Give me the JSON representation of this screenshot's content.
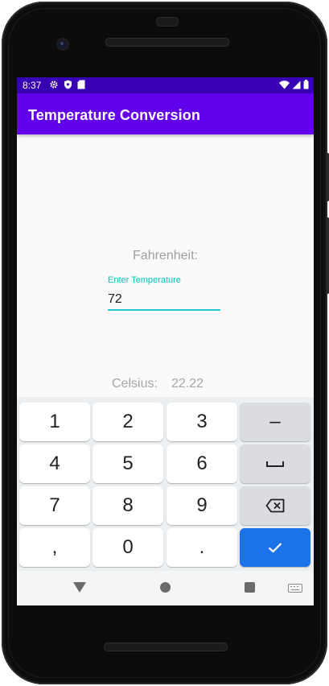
{
  "status_bar": {
    "time": "8:37",
    "icons_left": [
      "settings-icon",
      "shield-icon",
      "sd-card-icon"
    ],
    "icons_right": [
      "wifi-icon",
      "signal-icon",
      "battery-icon"
    ]
  },
  "app_bar": {
    "title": "Temperature Conversion",
    "color": "#6200ee",
    "status_color": "#3700b3"
  },
  "main": {
    "fahrenheit_label": "Fahrenheit:",
    "input": {
      "hint": "Enter Temperature",
      "value": "72",
      "accent_color": "#1fc8c8"
    },
    "celsius_label": "Celsius:",
    "celsius_value": "22.22"
  },
  "keyboard": {
    "rows": [
      [
        {
          "label": "1"
        },
        {
          "label": "2"
        },
        {
          "label": "3"
        },
        {
          "label": "–",
          "name": "minus-key"
        }
      ],
      [
        {
          "label": "4"
        },
        {
          "label": "5"
        },
        {
          "label": "6"
        },
        {
          "label": "␣",
          "name": "space-key"
        }
      ],
      [
        {
          "label": "7"
        },
        {
          "label": "8"
        },
        {
          "label": "9"
        },
        {
          "label": "⌫",
          "name": "backspace-key"
        }
      ],
      [
        {
          "label": ","
        },
        {
          "label": "0"
        },
        {
          "label": "."
        },
        {
          "label": "✓",
          "name": "done-key"
        }
      ]
    ],
    "done_color": "#1a73e8"
  },
  "nav_bar": {
    "icons": [
      "back-icon",
      "home-icon",
      "recents-icon",
      "keyboard-switch-icon"
    ]
  }
}
